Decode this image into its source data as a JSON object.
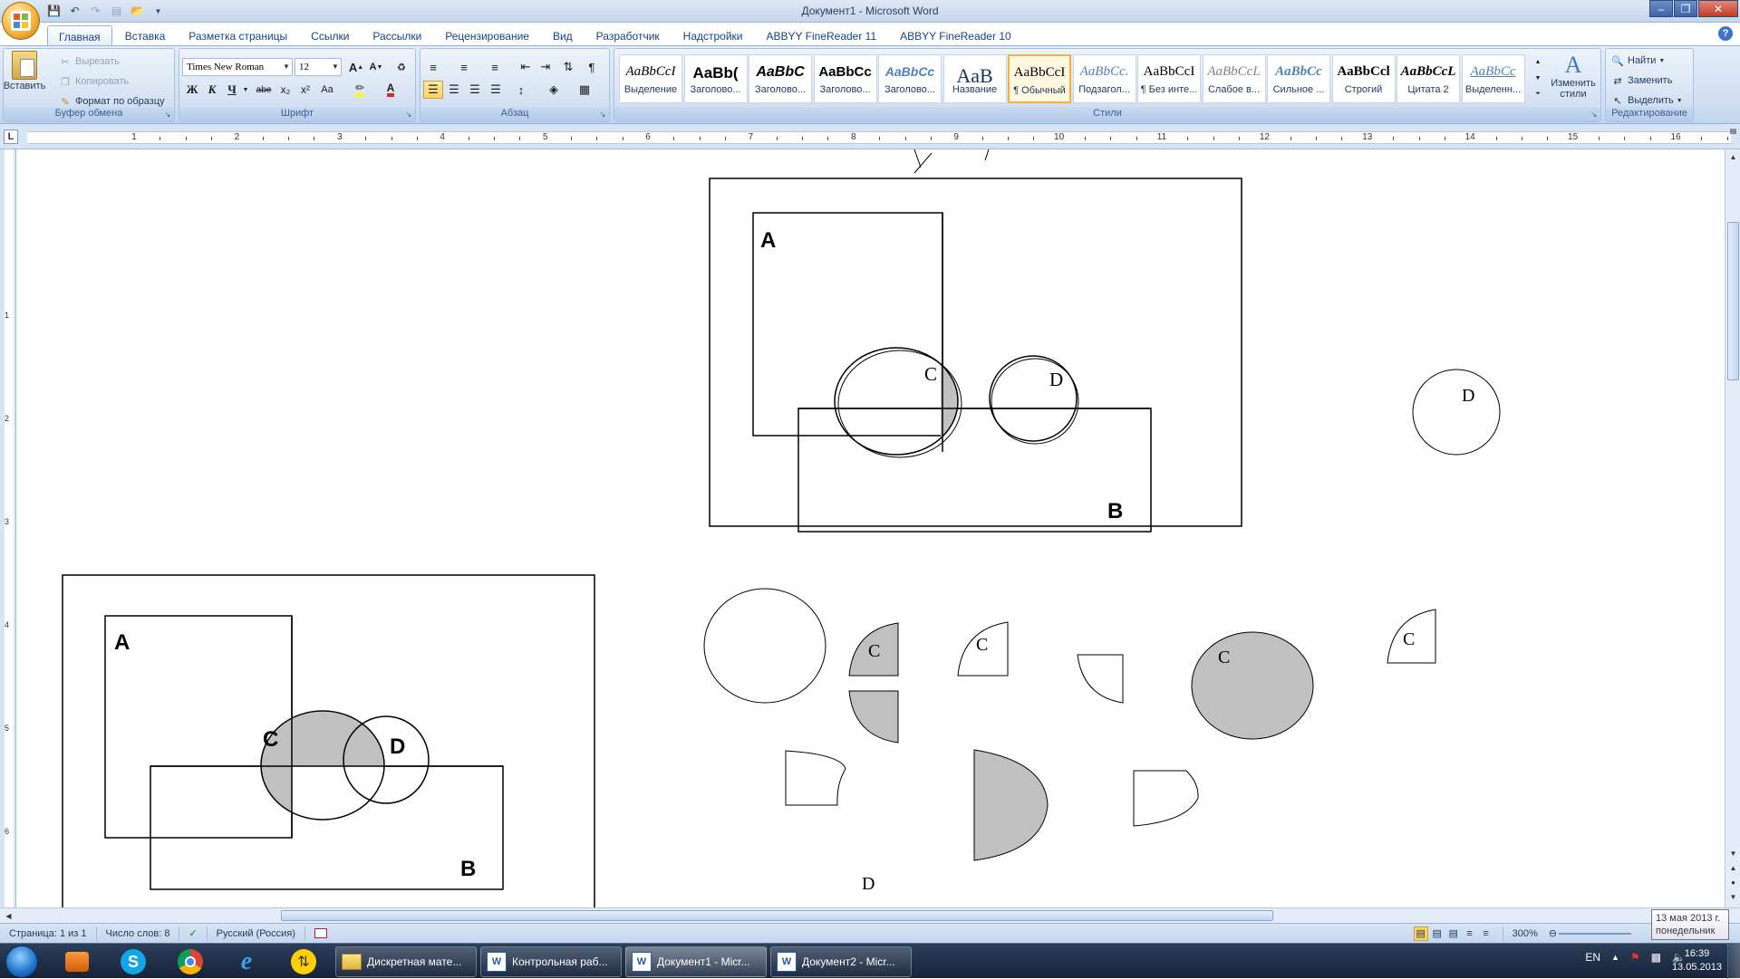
{
  "window": {
    "title": "Документ1 - Microsoft Word"
  },
  "tabs": [
    "Главная",
    "Вставка",
    "Разметка страницы",
    "Ссылки",
    "Рассылки",
    "Рецензирование",
    "Вид",
    "Разработчик",
    "Надстройки",
    "ABBYY FineReader 11",
    "ABBYY FineReader 10"
  ],
  "clipboard": {
    "paste": "Вставить",
    "cut": "Вырезать",
    "copy": "Копировать",
    "format_painter": "Формат по образцу",
    "label": "Буфер обмена"
  },
  "font": {
    "name": "Times New Roman",
    "size": "12",
    "label": "Шрифт",
    "bold": "Ж",
    "italic": "К",
    "underline": "Ч",
    "strike": "abe",
    "sub": "x₂",
    "sup": "x²",
    "case": "Aa",
    "grow": "A",
    "shrink": "A"
  },
  "paragraph": {
    "label": "Абзац"
  },
  "styles": {
    "label": "Стили",
    "items": [
      {
        "sample": "AaBbCcI",
        "name": "Выделение"
      },
      {
        "sample": "AaBb(",
        "name": "Заголово..."
      },
      {
        "sample": "AaBbC",
        "name": "Заголово..."
      },
      {
        "sample": "AaBbCc",
        "name": "Заголово..."
      },
      {
        "sample": "AaBbCc",
        "name": "Заголово..."
      },
      {
        "sample": "AaB",
        "name": "Название"
      },
      {
        "sample": "AaBbCcI",
        "name": "¶ Обычный"
      },
      {
        "sample": "AaBbCc.",
        "name": "Подзагол..."
      },
      {
        "sample": "AaBbCcI",
        "name": "¶ Без инте..."
      },
      {
        "sample": "AaBbCcL",
        "name": "Слабое в..."
      },
      {
        "sample": "AaBbCc",
        "name": "Сильное ..."
      },
      {
        "sample": "AaBbCcl",
        "name": "Строгий"
      },
      {
        "sample": "AaBbCcL",
        "name": "Цитата 2"
      },
      {
        "sample": "AaBbCc",
        "name": "Выделенн..."
      }
    ],
    "change": "Изменить стили"
  },
  "editing": {
    "find": "Найти",
    "replace": "Заменить",
    "select": "Выделить",
    "label": "Редактирование"
  },
  "ruler": {
    "numbers": [
      "1",
      "2",
      "3",
      "4",
      "5",
      "6",
      "7",
      "8",
      "9",
      "10",
      "11",
      "12",
      "13",
      "14",
      "15",
      "16"
    ],
    "vnumbers": [
      "1",
      "2",
      "3",
      "4",
      "5",
      "6"
    ]
  },
  "document": {
    "label_a": "A",
    "label_b": "B",
    "label_c": "C",
    "label_d": "D"
  },
  "status": {
    "page": "Страница: 1 из 1",
    "words": "Число слов: 8",
    "lang": "Русский (Россия)",
    "zoom": "300%"
  },
  "taskbar": {
    "tasks": [
      "Дискретная мате...",
      "Контрольная раб...",
      "Документ1 - Micr...",
      "Документ2 - Micr..."
    ],
    "lang": "EN",
    "time": "16:39",
    "date": "13.05.2013"
  },
  "tooltip": {
    "line1": "13 мая 2013 г.",
    "line2": "понедельник"
  }
}
